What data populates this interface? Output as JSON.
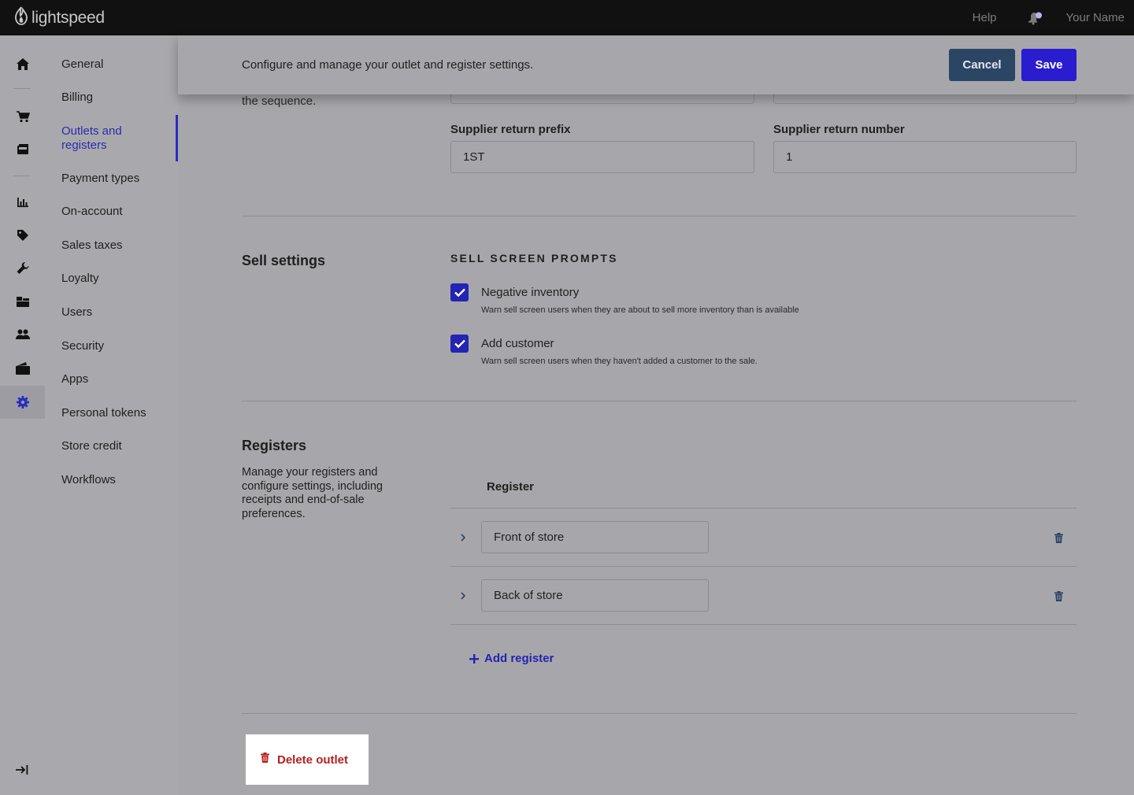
{
  "topbar": {
    "brand": "lightspeed",
    "help_label": "Help",
    "user_name": "Your Name",
    "icons": [
      "lightspeed-flame-icon",
      "bell-icon"
    ]
  },
  "rail": {
    "icons": [
      "home-icon",
      "cart-icon",
      "register-icon",
      "reports-icon",
      "tag-icon",
      "wrench-icon",
      "inventory-icon",
      "customers-icon",
      "wallet-icon",
      "settings-gear-icon",
      "collapse-icon"
    ],
    "active": "settings-gear-icon"
  },
  "subnav": {
    "items": [
      {
        "label": "General"
      },
      {
        "label": "Billing"
      },
      {
        "label": "Outlets and registers"
      },
      {
        "label": "Payment types"
      },
      {
        "label": "On-account"
      },
      {
        "label": "Sales taxes"
      },
      {
        "label": "Loyalty"
      },
      {
        "label": "Users"
      },
      {
        "label": "Security"
      },
      {
        "label": "Apps"
      },
      {
        "label": "Personal tokens"
      },
      {
        "label": "Store credit"
      },
      {
        "label": "Workflows"
      }
    ],
    "active_label": "Outlets and registers"
  },
  "header": {
    "description": "Configure and manage your outlet and register settings.",
    "cancel_label": "Cancel",
    "save_label": "Save"
  },
  "sequence": {
    "partial_text": "the sequence.",
    "supplier_return_prefix": {
      "label": "Supplier return prefix",
      "value": "1ST"
    },
    "supplier_return_number": {
      "label": "Supplier return number",
      "value": "1"
    }
  },
  "sell_settings": {
    "title": "Sell settings",
    "heading": "SELL SCREEN PROMPTS",
    "options": [
      {
        "label": "Negative inventory",
        "help": "Warn sell screen users when they are about to sell more inventory than is available",
        "checked": true
      },
      {
        "label": "Add customer",
        "help": "Warn sell screen users when they haven't added a customer to the sale.",
        "checked": true
      }
    ]
  },
  "registers": {
    "title": "Registers",
    "description": "Manage your registers and configure settings, including receipts and end-of-sale preferences.",
    "column_header": "Register",
    "rows": [
      {
        "name": "Front of store"
      },
      {
        "name": "Back of store"
      }
    ],
    "add_label": "Add register"
  },
  "delete_outlet_label": "Delete outlet",
  "colors": {
    "accent": "#2a1dd0",
    "cancel": "#2b4565",
    "danger": "#b51f1f",
    "topbar": "#111111"
  }
}
